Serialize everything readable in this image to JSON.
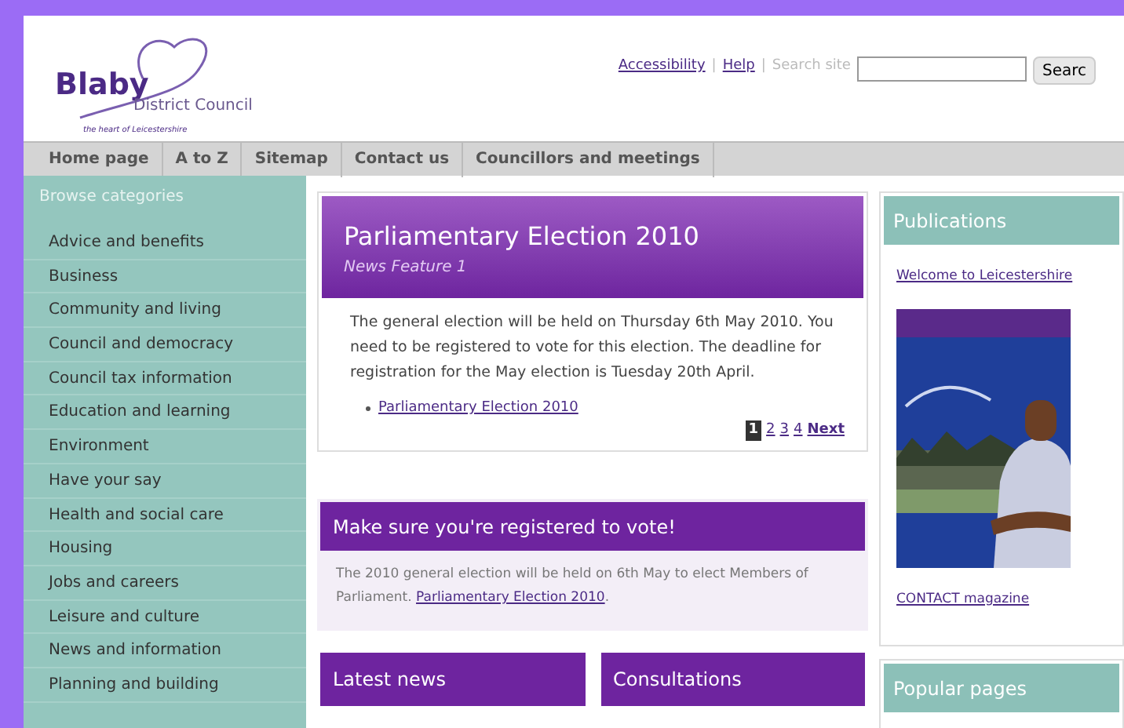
{
  "header": {
    "logo": {
      "name": "Blaby",
      "subtitle": "District Council",
      "tagline": "the heart of Leicestershire"
    },
    "links": [
      {
        "label": "Accessibility"
      },
      {
        "label": "Help"
      }
    ],
    "separators": [
      "|",
      "|"
    ],
    "search": {
      "label": "Search site",
      "button": "Searc"
    }
  },
  "nav": [
    {
      "label": "Home page"
    },
    {
      "label": "A to Z"
    },
    {
      "label": "Sitemap"
    },
    {
      "label": "Contact us"
    },
    {
      "label": "Councillors and meetings"
    }
  ],
  "sidebar": {
    "title": "Browse categories",
    "items": [
      {
        "label": "Advice and benefits"
      },
      {
        "label": "Business"
      },
      {
        "label": "Community and living"
      },
      {
        "label": "Council and democracy"
      },
      {
        "label": "Council tax information"
      },
      {
        "label": "Education and learning"
      },
      {
        "label": "Environment"
      },
      {
        "label": "Have your say"
      },
      {
        "label": "Health and social care"
      },
      {
        "label": "Housing"
      },
      {
        "label": "Jobs and careers"
      },
      {
        "label": "Leisure and culture"
      },
      {
        "label": "News and information"
      },
      {
        "label": "Planning and building"
      }
    ]
  },
  "feature": {
    "title": "Parliamentary Election 2010",
    "subtitle": "News Feature 1",
    "body": "The general election will be held on Thursday 6th May 2010. You need to be registered to vote for this election. The deadline for registration for the May election is Tuesday 20th April.",
    "links": [
      "Parliamentary Election 2010"
    ],
    "pages": [
      {
        "label": "1",
        "selected": true
      },
      {
        "label": "2",
        "selected": false
      },
      {
        "label": "3",
        "selected": false
      },
      {
        "label": "4",
        "selected": false
      }
    ],
    "next": "Next"
  },
  "notice": {
    "title": "Make sure you're registered to vote!",
    "body": "The 2010 general election will be held on 6th May to elect Members of Parliament.",
    "link": "Parliamentary Election 2010",
    "end": "."
  },
  "panels": [
    {
      "title": "Latest news"
    },
    {
      "title": "Consultations"
    }
  ],
  "right": {
    "publications": {
      "title": "Publications",
      "link": "Welcome to Leicestershire",
      "caption": "CONTACT magazine"
    },
    "popular": {
      "title": "Popular pages"
    }
  }
}
